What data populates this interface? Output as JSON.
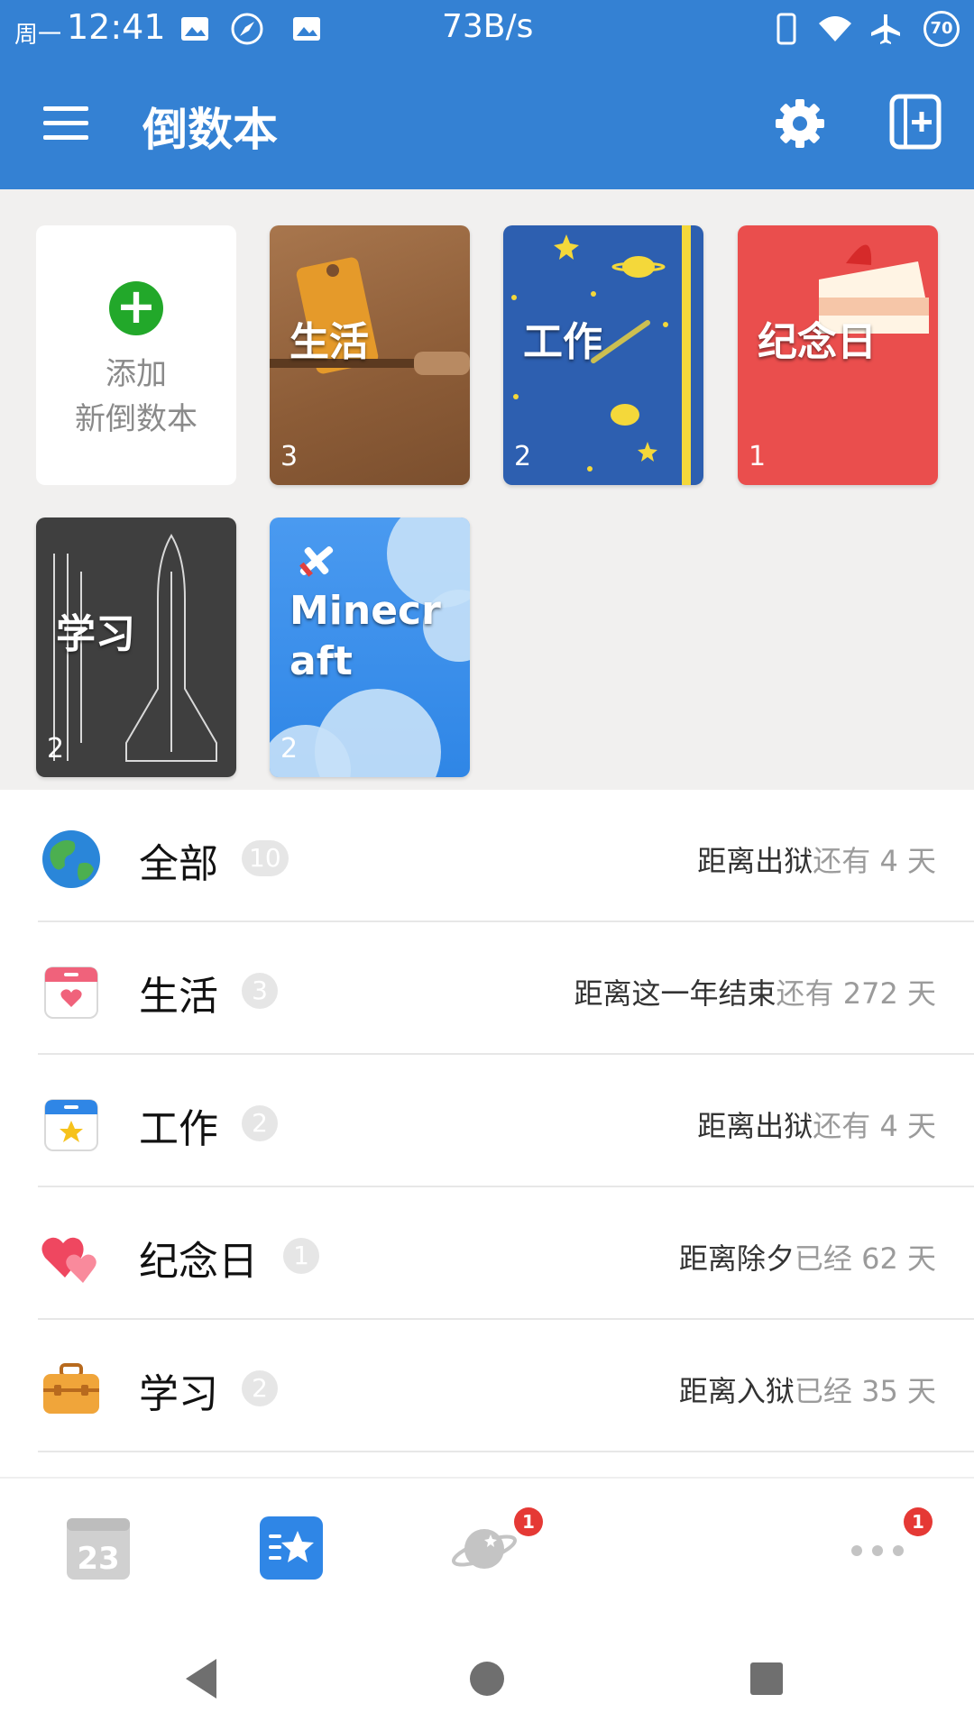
{
  "statusbar": {
    "day": "周一",
    "time": "12:41",
    "net_speed": "73B/s",
    "battery": "70",
    "icons": [
      "image-icon",
      "compass-icon",
      "image-icon",
      "phone-icon",
      "wifi-icon",
      "airplane-icon",
      "battery-icon"
    ]
  },
  "appbar": {
    "title": "倒数本",
    "icons": [
      "menu-icon",
      "gear-icon",
      "add-book-icon"
    ]
  },
  "books": {
    "add_line1": "添加",
    "add_line2": "新倒数本",
    "items": [
      {
        "name": "生活",
        "count": "3",
        "color": "#9a6a44"
      },
      {
        "name": "工作",
        "count": "2",
        "color": "#2d5fb0"
      },
      {
        "name": "纪念日",
        "count": "1",
        "color": "#ea4e4d"
      },
      {
        "name": "学习",
        "count": "2",
        "color": "#3f3f3f"
      },
      {
        "name_line1": "Minecr",
        "name_line2": "aft",
        "count": "2",
        "color": "#3b8fe8"
      }
    ]
  },
  "list": [
    {
      "name": "全部",
      "badge": "10",
      "label": "距离出狱",
      "status": "还有",
      "days": "4",
      "unit": "天",
      "icon": "globe-icon"
    },
    {
      "name": "生活",
      "badge": "3",
      "label": "距离这一年结束",
      "status": "还有",
      "days": "272",
      "unit": "天",
      "icon": "calendar-heart-icon"
    },
    {
      "name": "工作",
      "badge": "2",
      "label": "距离出狱",
      "status": "还有",
      "days": "4",
      "unit": "天",
      "icon": "calendar-star-icon"
    },
    {
      "name": "纪念日",
      "badge": "1",
      "label": "距离除夕",
      "status": "已经",
      "days": "62",
      "unit": "天",
      "icon": "hearts-icon"
    },
    {
      "name": "学习",
      "badge": "2",
      "label": "距离入狱",
      "status": "已经",
      "days": "35",
      "unit": "天",
      "icon": "briefcase-icon"
    }
  ],
  "bottomnav": {
    "calendar_number": "23",
    "badge_planet": "1",
    "badge_more": "1"
  },
  "colors": {
    "primary": "#3481d3",
    "accent_green": "#22a82a",
    "badge_red": "#e53935"
  }
}
